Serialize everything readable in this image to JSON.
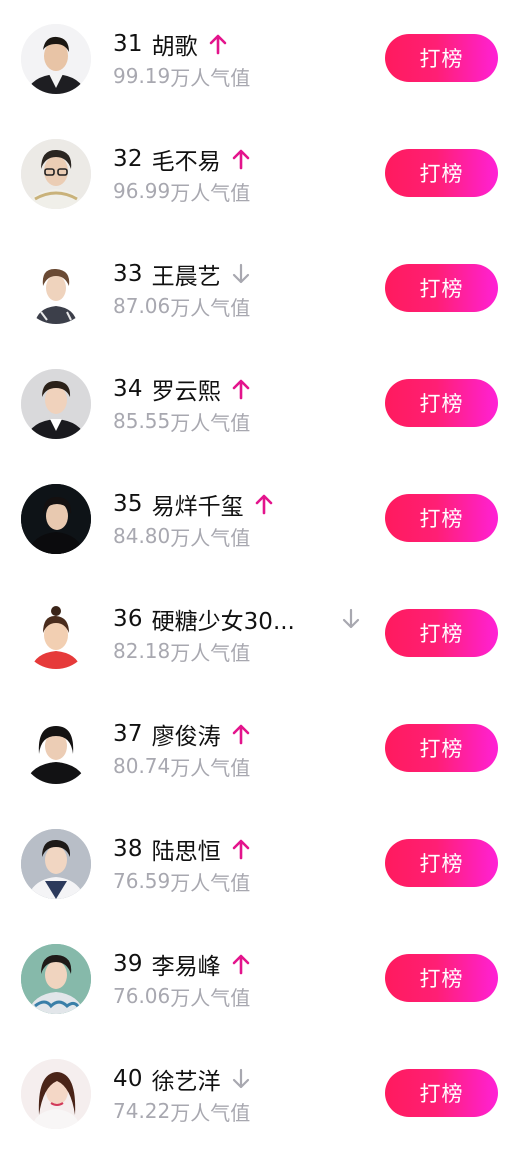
{
  "trend_colors": {
    "up": "#e3148c",
    "down": "#a8a8b0"
  },
  "button_gradient": [
    "#ff1a5e",
    "#ff21d6"
  ],
  "ranking": [
    {
      "rank": "31",
      "name": "胡歌",
      "score": "99.19",
      "unit": "万人气值",
      "trend": "up",
      "icon": "avatar-hu-ge"
    },
    {
      "rank": "32",
      "name": "毛不易",
      "score": "96.99",
      "unit": "万人气值",
      "trend": "up",
      "icon": "avatar-mao-buyi"
    },
    {
      "rank": "33",
      "name": "王晨艺",
      "score": "87.06",
      "unit": "万人气值",
      "trend": "down",
      "icon": "avatar-wang-chenyi"
    },
    {
      "rank": "34",
      "name": "罗云熙",
      "score": "85.55",
      "unit": "万人气值",
      "trend": "up",
      "icon": "avatar-luo-yunxi"
    },
    {
      "rank": "35",
      "name": "易烊千玺",
      "score": "84.80",
      "unit": "万人气值",
      "trend": "up",
      "icon": "avatar-yi-yangqianxi"
    },
    {
      "rank": "36",
      "name": "硬糖少女30...",
      "score": "82.18",
      "unit": "万人气值",
      "trend": "down",
      "icon": "avatar-yingtang-shaonv"
    },
    {
      "rank": "37",
      "name": "廖俊涛",
      "score": "80.74",
      "unit": "万人气值",
      "trend": "up",
      "icon": "avatar-liao-juntao"
    },
    {
      "rank": "38",
      "name": "陆思恒",
      "score": "76.59",
      "unit": "万人气值",
      "trend": "up",
      "icon": "avatar-lu-siheng"
    },
    {
      "rank": "39",
      "name": "李易峰",
      "score": "76.06",
      "unit": "万人气值",
      "trend": "up",
      "icon": "avatar-li-yifeng"
    },
    {
      "rank": "40",
      "name": "徐艺洋",
      "score": "74.22",
      "unit": "万人气值",
      "trend": "down",
      "icon": "avatar-xu-yiyang"
    }
  ],
  "vote_button_label": "打榜"
}
